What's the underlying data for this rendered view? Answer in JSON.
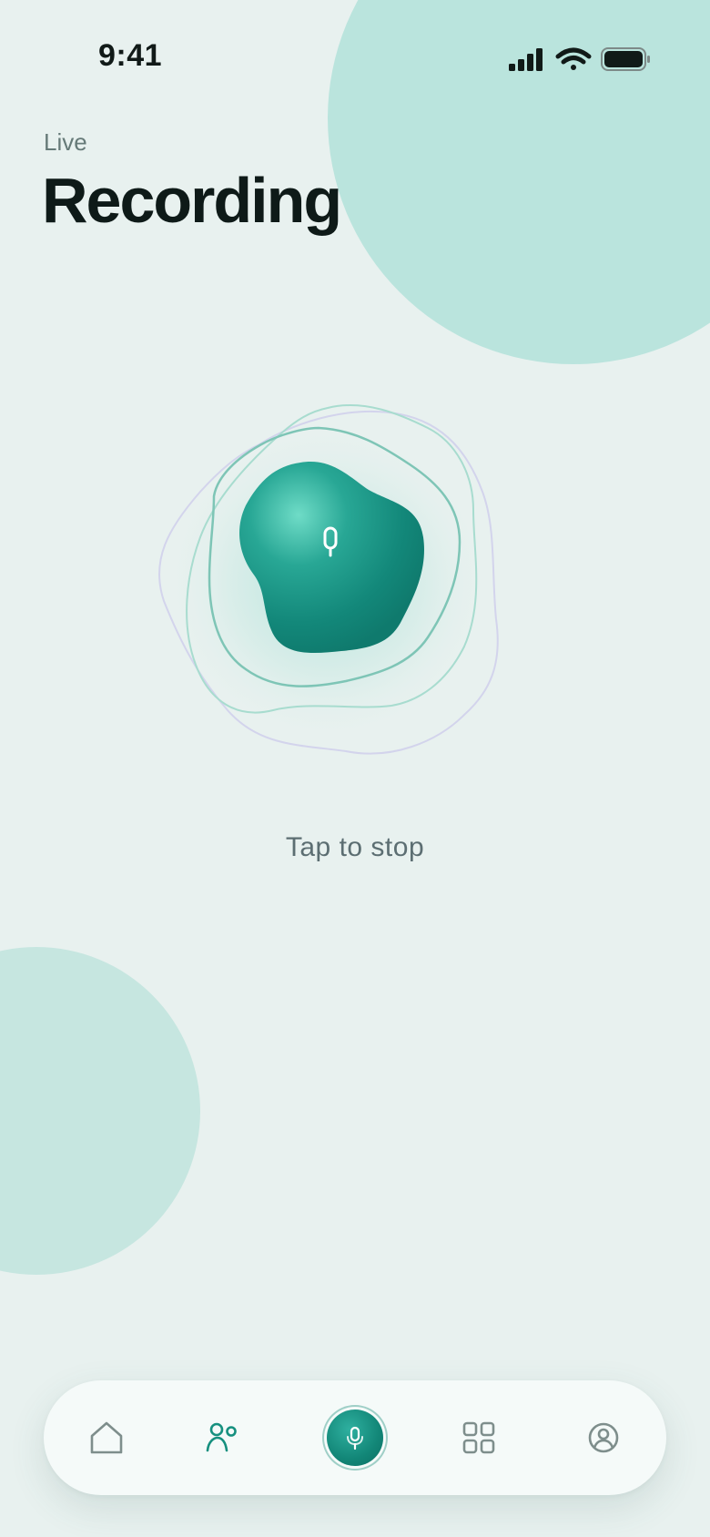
{
  "status_bar": {
    "time": "9:41",
    "icons": [
      "signal-icon",
      "wifi-icon",
      "battery-icon"
    ]
  },
  "header": {
    "subtitle": "Live",
    "title": "Recording"
  },
  "recorder": {
    "state": "recording",
    "button_icon": "microphone-icon",
    "hint": "Tap to stop"
  },
  "nav": {
    "items": [
      {
        "icon": "home-icon",
        "active": false
      },
      {
        "icon": "people-icon",
        "active": true
      },
      {
        "icon": "microphone-icon",
        "active": true
      },
      {
        "icon": "grid-icon",
        "active": false
      },
      {
        "icon": "profile-icon",
        "active": false
      }
    ]
  },
  "colors": {
    "background": "#e8f1ef",
    "accent": "#128677",
    "accent_light": "#5fd3c0",
    "blob": "#bae4dd",
    "text_primary": "#0e1a18",
    "text_secondary": "#667a78",
    "ring_lavender": "#d3d4ec"
  }
}
